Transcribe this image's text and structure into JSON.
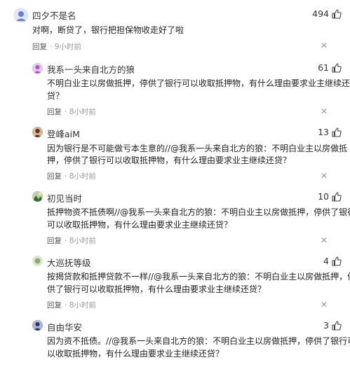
{
  "comments": [
    {
      "username": "四夕不是名",
      "likes": "494",
      "lines": [
        "对啊，断贷了，银行把担保物收走好了啦"
      ],
      "reply_label": "回复",
      "time": "9小时前",
      "avatar_color": "#6b7fd0"
    },
    {
      "username": "我系一头来自北方的狼",
      "likes": "61",
      "lines": [
        "不明白业主以房做抵押，停供了银行可以收取抵押物，有什么理由要求业主继续还",
        "贷？"
      ],
      "reply_label": "回复",
      "time": "8小时前",
      "avatar_color": "#c79ad9"
    },
    {
      "username": "登峰aiM",
      "likes": "13",
      "lines": [
        "因为银行是不可能做亏本生意的//@我系一头来自北方的狼：不明白业主以房做抵",
        "押，停供了银行可以收取抵押物，有什么理由要求业主继续还贷？"
      ],
      "reply_label": "回复",
      "time": "8小时前",
      "avatar_color": "#8a5a3a"
    },
    {
      "username": "初见当时",
      "likes": "10",
      "lines": [
        "抵押物资不抵债啊//@我系一头来自北方的狼：不明白业主以房做抵押，停供了银行",
        "可以收取抵押物，有什么理由要求业主继续还贷？"
      ],
      "reply_label": "回复",
      "time": "8小时前",
      "avatar_color": "#5f8a55"
    },
    {
      "username": "大巡抚等级",
      "likes": "4",
      "lines": [
        "按揭贷款和抵押贷款不一样//@我系一头来自北方的狼：不明白业主以房做抵押，停",
        "供了银行可以收取抵押物，有什么理由要求业主继续还贷？"
      ],
      "reply_label": "回复",
      "time": "8小时前",
      "avatar_color": "#c9d6b8"
    },
    {
      "username": "自由华安",
      "likes": "3",
      "lines": [
        "因为资不抵债。//@我系一头来自北方的狼：不明白业主以房做抵押，停供了银行可",
        "以收取抵押物，有什么理由要求业主继续还贷？"
      ],
      "reply_label": "",
      "time": "",
      "avatar_color": "#3a4a7a"
    }
  ],
  "icons": {
    "like": "thumbs-up-icon",
    "dismiss": "close-icon",
    "avatar": "user-avatar"
  }
}
